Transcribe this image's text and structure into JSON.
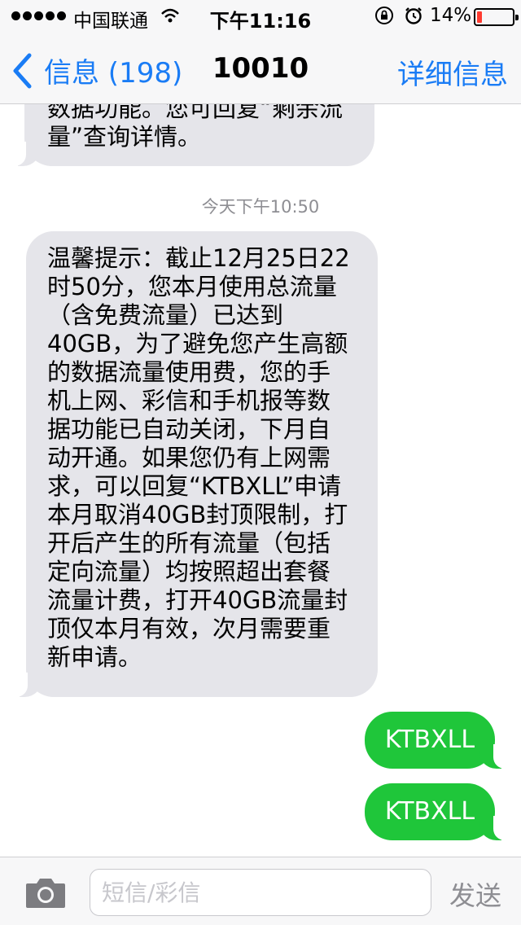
{
  "status_bar": {
    "carrier": "中国联通",
    "time": "下午11:16",
    "battery": "14%",
    "battery_level": 0.14,
    "signal_icon": "signal-dots-icon",
    "wifi_icon": "wifi-icon",
    "lock_icon": "orientation-lock-icon",
    "alarm_icon": "alarm-icon",
    "battery_color": "#ff3b30"
  },
  "nav": {
    "back_label": "信息 (198)",
    "title": "10010",
    "details_label": "详细信息",
    "accent": "#1a7cf5"
  },
  "messages": {
    "prev_fragment": "数据功能。您可回复“剩余流\n量”查询详情。",
    "timestamp": "今天下午10:50",
    "main": "温馨提示：截止12月25日22\n时50分，您本月使用总流量\n（含免费流量）已达到\n40GB，为了避免您产生高额\n的数据流量使用费，您的手\n机上网、彩信和手机报等数\n据功能已自动关闭，下月自\n动开通。如果您仍有上网需\n求，可以回复“KTBXLL”申请\n本月取消40GB封顶限制，打\n开后产生的所有流量（包括\n定向流量）均按照超出套餐\n流量计费，打开40GB流量封\n顶仅本月有效，次月需要重\n新申请。",
    "out1": "KTBXLL",
    "out2": "KTBXLL",
    "incoming_color": "#e5e5ea",
    "outgoing_color": "#1fc63a"
  },
  "input_bar": {
    "camera_icon": "camera-icon",
    "placeholder": "短信/彩信",
    "value": "",
    "send_label": "发送"
  }
}
